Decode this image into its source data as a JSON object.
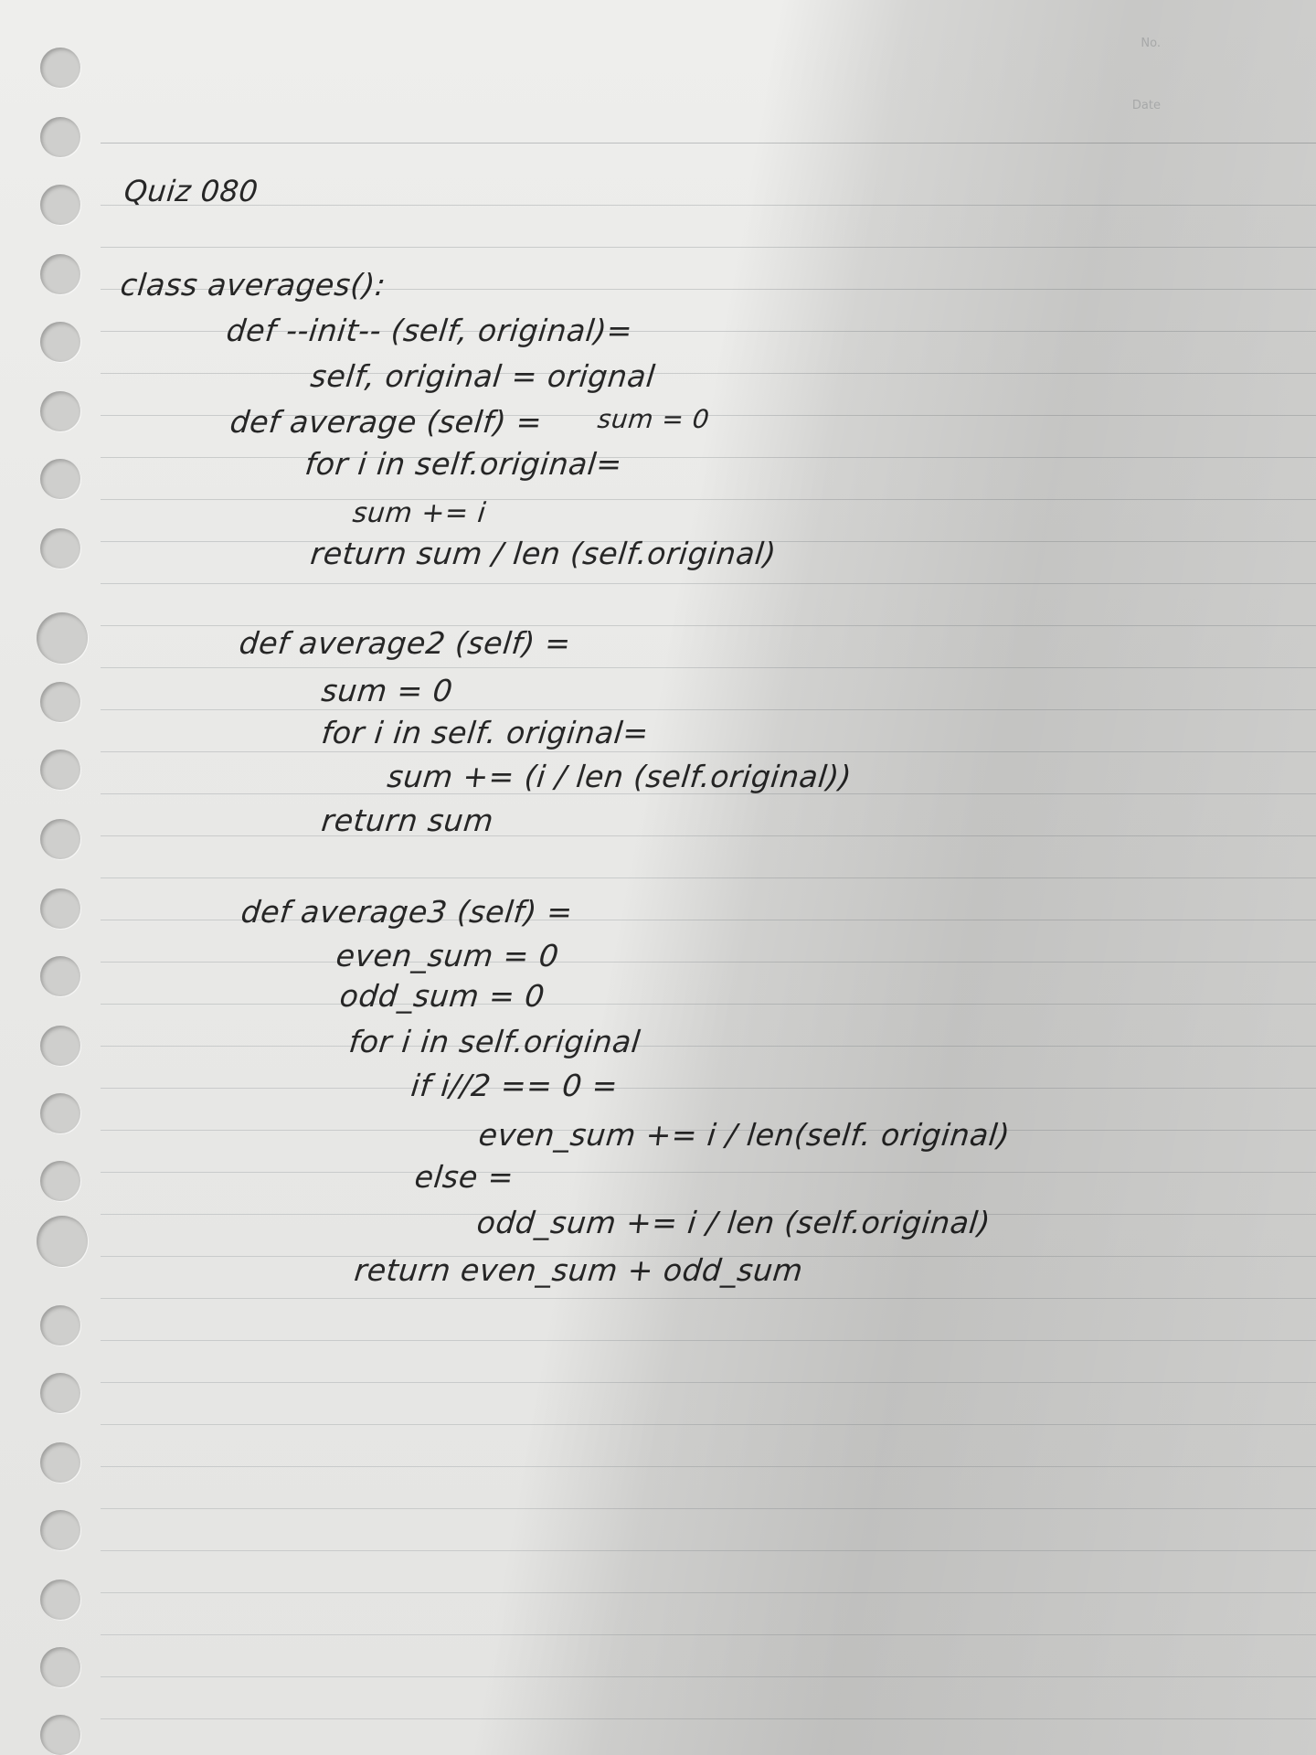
{
  "header": {
    "no_label": "No.",
    "date_label": "Date"
  },
  "title": "Quiz 080",
  "code_lines": [
    "class averages():",
    "def --init-- (self, original)=",
    "self, original = orignal",
    "def average (self) =",
    "sum = 0",
    "for i in self.original=",
    "sum += i",
    "return sum / len (self.original)",
    "def average2 (self) =",
    "sum = 0",
    "for i in self. original=",
    "sum += (i / len (self.original))",
    "return sum",
    "def average3 (self) =",
    "even_sum = 0",
    "odd_sum = 0",
    "for i in self.original",
    "if i//2 == 0 =",
    "even_sum += i / len(self. original)",
    "else =",
    "odd_sum += i / len (self.original)",
    "return even_sum + odd_sum"
  ]
}
